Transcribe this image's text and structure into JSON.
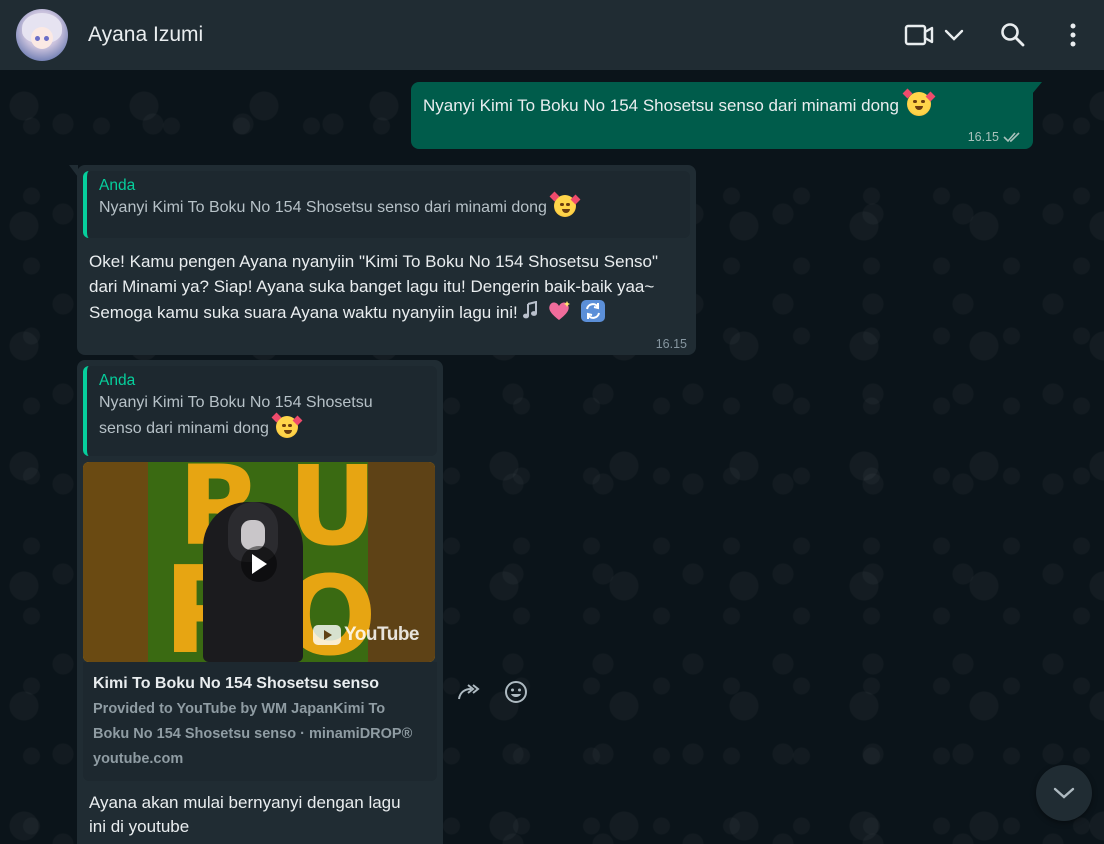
{
  "header": {
    "contact_name": "Ayana Izumi",
    "icons": [
      "video-call-icon",
      "chevron-down-icon",
      "search-icon",
      "menu-dots-icon"
    ]
  },
  "messages": {
    "outgoing": {
      "text": "Nyanyi Kimi To Boku No 154 Shosetsu senso dari minami dong",
      "time": "16.15",
      "status": "read"
    },
    "reply1": {
      "quote_author": "Anda",
      "quote_text": "Nyanyi Kimi To Boku No 154 Shosetsu senso dari minami dong",
      "text": "Oke! Kamu pengen Ayana nyanyiin \"Kimi To Boku No 154 Shosetsu Senso\" dari Minami ya? Siap! Ayana suka banget lagu itu! Dengerin baik-baik yaa~ Semoga kamu suka suara Ayana waktu nyanyiin lagu ini!",
      "time": "16.15"
    },
    "reply2": {
      "quote_author": "Anda",
      "quote_text_line1": "Nyanyi Kimi To Boku No 154 Shosetsu",
      "quote_text_line2": "senso dari minami dong",
      "video_brand": "YouTube",
      "link_title": "Kimi To Boku No 154 Shosetsu senso",
      "link_desc_line1": "Provided to YouTube by WM JapanKimi To",
      "link_desc_line2": "Boku No 154 Shosetsu senso · minamiDROP®",
      "link_domain": "youtube.com",
      "text_line1": "Ayana akan mulai bernyanyi dengan lagu",
      "text_line2": "ini di youtube"
    }
  },
  "colors": {
    "header_bg": "#202c33",
    "outgoing_bubble": "#005c4b",
    "incoming_bubble": "#202c33",
    "accent": "#06cf9c",
    "read_tick": "#a9c2bc"
  }
}
